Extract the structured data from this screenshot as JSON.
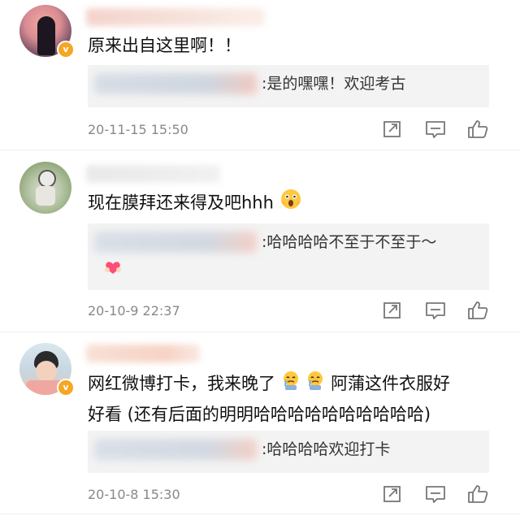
{
  "comments": [
    {
      "text": "原来出自这里啊！！",
      "reply_text": ":是的嘿嘿！欢迎考古",
      "time": "20-11-15 15:50",
      "badge": "v"
    },
    {
      "text": "现在膜拜还来得及吧hhh",
      "reply_text": ":哈哈哈哈不至于不至于～",
      "time": "20-10-9 22:37"
    },
    {
      "text_line1": "网红微博打卡，我来晚了",
      "text_line1_tail": "阿蒲这件衣服好",
      "text_line2": "好看 (还有后面的明明哈哈哈哈哈哈哈哈哈哈)",
      "reply_text": ":哈哈哈哈欢迎打卡",
      "time": "20-10-8 15:30",
      "badge": "v"
    }
  ],
  "icons": [
    "share-icon",
    "comment-icon",
    "like-icon"
  ],
  "colors": {
    "badge": "#f5a623",
    "reply_bg": "#f3f3f3",
    "time": "#888888"
  }
}
